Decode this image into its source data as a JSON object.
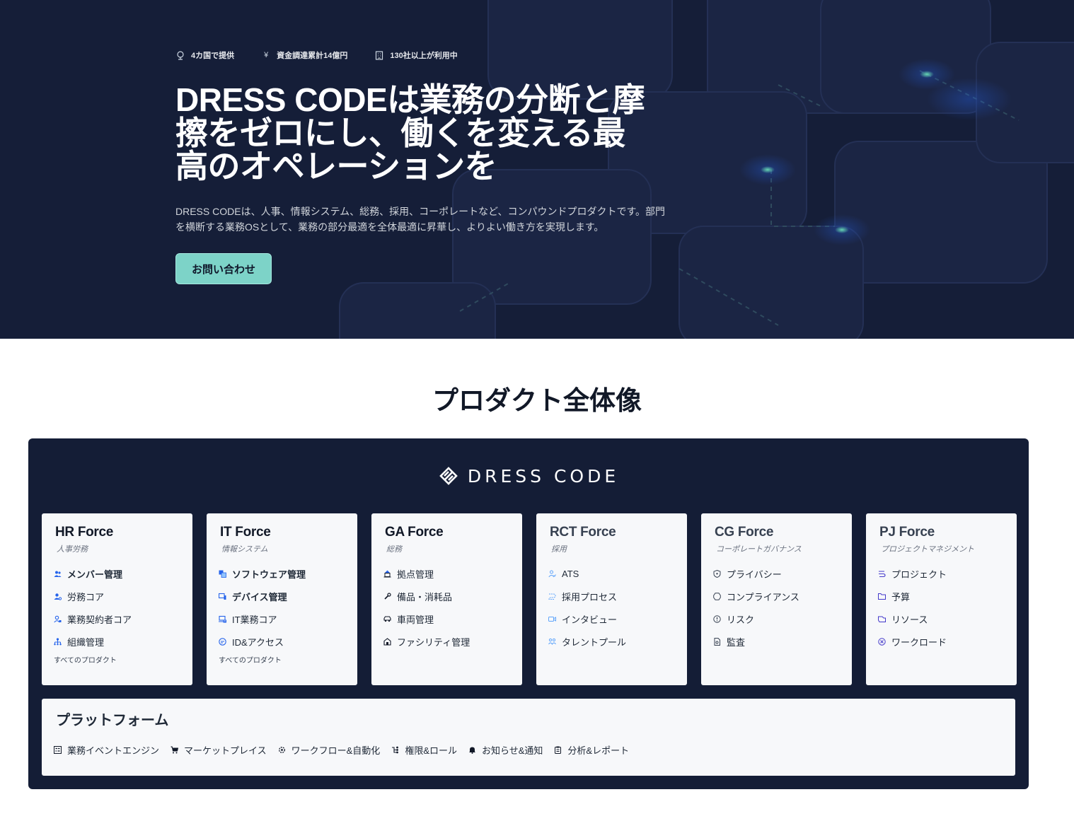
{
  "hero": {
    "stats": [
      {
        "icon": "globe-icon",
        "label": "4カ国で提供"
      },
      {
        "icon": "yen-icon",
        "label": "資金調達累計14億円"
      },
      {
        "icon": "building-icon",
        "label": "130社以上が利用中"
      }
    ],
    "headline_lines": [
      "DRESS CODEは業務の分断と摩",
      "擦をゼロにし、働くを変える最",
      "高のオペレーションを"
    ],
    "lead_lines": [
      "DRESS CODEは、人事、情報システム、総務、採用、コーポレートなど、コンパウンドプロダクトです。部門",
      "を横断する業務OSとして、業務の部分最適を全体最適に昇華し、よりよい働き方を実現します。"
    ],
    "cta_label": "お問い合わせ"
  },
  "section": {
    "title": "プロダクト全体像"
  },
  "brand": {
    "name": "DRESS CODE"
  },
  "colors": {
    "hero_bg": "#151e38",
    "panel_bg": "#141d36",
    "accent": "#7dd3c8",
    "icon_blue": "#2563eb"
  },
  "products": [
    {
      "title": "HR Force",
      "subtitle": "人事労務",
      "items": [
        {
          "label": "メンバー管理",
          "icon": "members-icon"
        },
        {
          "label": "労務コア",
          "icon": "user-settings-icon"
        },
        {
          "label": "業務契約者コア",
          "icon": "contractor-icon"
        },
        {
          "label": "組織管理",
          "icon": "org-chart-icon"
        }
      ],
      "more": "すべてのプロダクト"
    },
    {
      "title": "IT Force",
      "subtitle": "情報システム",
      "items": [
        {
          "label": "ソフトウェア管理",
          "icon": "software-icon"
        },
        {
          "label": "デバイス管理",
          "icon": "device-icon"
        },
        {
          "label": "IT業務コア",
          "icon": "laptop-icon"
        },
        {
          "label": "ID&アクセス",
          "icon": "id-access-icon"
        }
      ],
      "more": "すべてのプロダクト"
    },
    {
      "title": "GA Force",
      "subtitle": "総務",
      "items": [
        {
          "label": "拠点管理",
          "icon": "office-icon"
        },
        {
          "label": "備品・消耗品",
          "icon": "tools-icon"
        },
        {
          "label": "車両管理",
          "icon": "car-icon"
        },
        {
          "label": "ファシリティ管理",
          "icon": "facility-icon"
        }
      ],
      "more": ""
    },
    {
      "title": "RCT Force",
      "subtitle": "採用",
      "items": [
        {
          "label": "ATS",
          "icon": "applicant-icon"
        },
        {
          "label": "採用プロセス",
          "icon": "process-icon"
        },
        {
          "label": "インタビュー",
          "icon": "video-icon"
        },
        {
          "label": "タレントプール",
          "icon": "talent-icon"
        }
      ],
      "more": ""
    },
    {
      "title": "CG Force",
      "subtitle": "コーポレートガバナンス",
      "items": [
        {
          "label": "プライバシー",
          "icon": "shield-icon"
        },
        {
          "label": "コンプライアンス",
          "icon": "compliance-icon"
        },
        {
          "label": "リスク",
          "icon": "alert-icon"
        },
        {
          "label": "監査",
          "icon": "audit-icon"
        }
      ],
      "more": ""
    },
    {
      "title": "PJ Force",
      "subtitle": "プロジェクトマネジメント",
      "items": [
        {
          "label": "プロジェクト",
          "icon": "project-icon"
        },
        {
          "label": "予算",
          "icon": "budget-icon"
        },
        {
          "label": "リソース",
          "icon": "resource-icon"
        },
        {
          "label": "ワークロード",
          "icon": "workload-icon"
        }
      ],
      "more": ""
    }
  ],
  "platform": {
    "title": "プラットフォーム",
    "items": [
      {
        "label": "業務イベントエンジン",
        "icon": "event-engine-icon"
      },
      {
        "label": "マーケットプレイス",
        "icon": "cart-icon"
      },
      {
        "label": "ワークフロー&自動化",
        "icon": "workflow-icon"
      },
      {
        "label": "権限&ロール",
        "icon": "permission-icon"
      },
      {
        "label": "お知らせ&通知",
        "icon": "bell-icon"
      },
      {
        "label": "分析&レポート",
        "icon": "report-icon"
      }
    ]
  }
}
